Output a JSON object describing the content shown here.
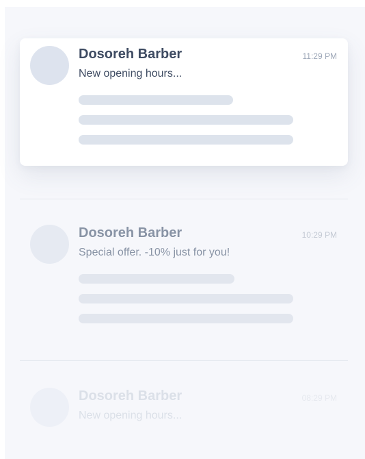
{
  "notifications": [
    {
      "sender": "Dosoreh Barber",
      "time": "11:29 PM",
      "preview": "New opening hours..."
    },
    {
      "sender": "Dosoreh Barber",
      "time": "10:29 PM",
      "preview": "Special offer. -10% just for you!"
    },
    {
      "sender": "Dosoreh Barber",
      "time": "08:29 PM",
      "preview": "New opening hours..."
    }
  ],
  "colors": {
    "background": "#f6f7fb",
    "card": "#ffffff",
    "title_text": "#3e4b62",
    "placeholder": "#dde3ec",
    "avatar": "#dde3ee"
  }
}
